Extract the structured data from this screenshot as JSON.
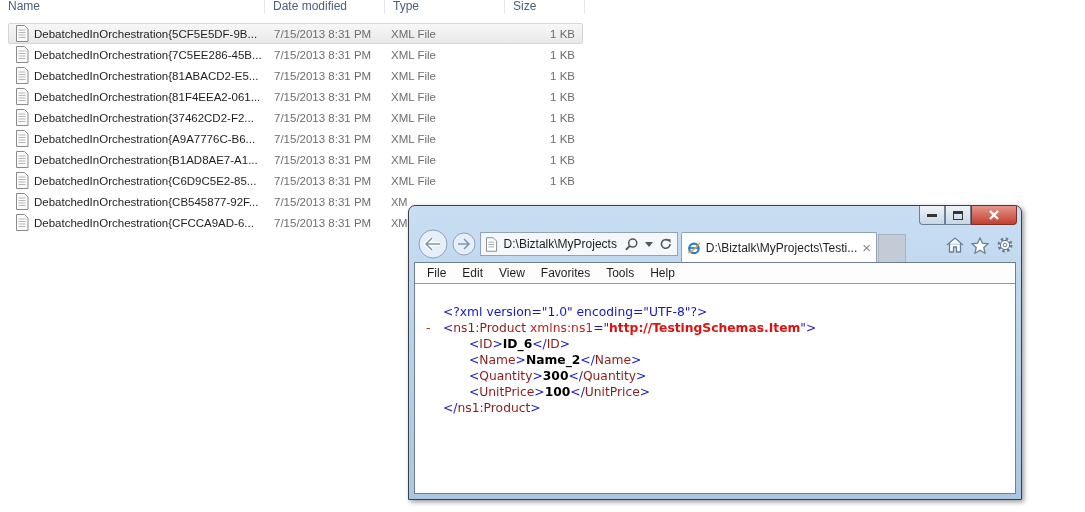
{
  "explorer": {
    "columns": [
      "Name",
      "Date modified",
      "Type",
      "Size"
    ],
    "rows": [
      {
        "name": "DebatchedInOrchestration{5CF5E5DF-9B...",
        "date": "7/15/2013 8:31 PM",
        "type": "XML File",
        "size": "1 KB",
        "selected": true
      },
      {
        "name": "DebatchedInOrchestration{7C5EE286-45B...",
        "date": "7/15/2013 8:31 PM",
        "type": "XML File",
        "size": "1 KB",
        "selected": false
      },
      {
        "name": "DebatchedInOrchestration{81ABACD2-E5...",
        "date": "7/15/2013 8:31 PM",
        "type": "XML File",
        "size": "1 KB",
        "selected": false
      },
      {
        "name": "DebatchedInOrchestration{81F4EEA2-061...",
        "date": "7/15/2013 8:31 PM",
        "type": "XML File",
        "size": "1 KB",
        "selected": false
      },
      {
        "name": "DebatchedInOrchestration{37462CD2-F2...",
        "date": "7/15/2013 8:31 PM",
        "type": "XML File",
        "size": "1 KB",
        "selected": false
      },
      {
        "name": "DebatchedInOrchestration{A9A7776C-B6...",
        "date": "7/15/2013 8:31 PM",
        "type": "XML File",
        "size": "1 KB",
        "selected": false
      },
      {
        "name": "DebatchedInOrchestration{B1AD8AE7-A1...",
        "date": "7/15/2013 8:31 PM",
        "type": "XML File",
        "size": "1 KB",
        "selected": false
      },
      {
        "name": "DebatchedInOrchestration{C6D9C5E2-85...",
        "date": "7/15/2013 8:31 PM",
        "type": "XML File",
        "size": "1 KB",
        "selected": false
      },
      {
        "name": "DebatchedInOrchestration{CB545877-92F...",
        "date": "7/15/2013 8:31 PM",
        "type": "XM",
        "selected": false
      },
      {
        "name": "DebatchedInOrchestration{CFCCA9AD-6...",
        "date": "7/15/2013 8:31 PM",
        "type": "XM",
        "selected": false
      }
    ]
  },
  "browser": {
    "address": "D:\\Biztalk\\MyProjects",
    "tab": {
      "title": "D:\\Biztalk\\MyProjects\\Testi...",
      "close": "×"
    },
    "menu": [
      "File",
      "Edit",
      "View",
      "Favorites",
      "Tools",
      "Help"
    ],
    "xml": {
      "declaration": "<?xml version=\"1.0\" encoding=\"UTF-8\"?>",
      "root": {
        "toggle": "-",
        "open": [
          {
            "kind": "bracket",
            "text": "<"
          },
          {
            "kind": "tag",
            "text": "ns1:Product"
          },
          {
            "kind": "attr",
            "text": " xmlns:ns1"
          },
          {
            "kind": "bracket",
            "text": "=\""
          },
          {
            "kind": "attrval",
            "text": "http://TestingSchemas.Item"
          },
          {
            "kind": "bracket",
            "text": "\">"
          }
        ],
        "children": [
          {
            "tokens": [
              {
                "kind": "bracket",
                "text": "<"
              },
              {
                "kind": "tag",
                "text": "ID"
              },
              {
                "kind": "bracket",
                "text": ">"
              },
              {
                "kind": "text",
                "text": "ID_6"
              },
              {
                "kind": "bracket",
                "text": "</"
              },
              {
                "kind": "tag",
                "text": "ID"
              },
              {
                "kind": "bracket",
                "text": ">"
              }
            ]
          },
          {
            "tokens": [
              {
                "kind": "bracket",
                "text": "<"
              },
              {
                "kind": "tag",
                "text": "Name"
              },
              {
                "kind": "bracket",
                "text": ">"
              },
              {
                "kind": "text",
                "text": "Name_2"
              },
              {
                "kind": "bracket",
                "text": "</"
              },
              {
                "kind": "tag",
                "text": "Name"
              },
              {
                "kind": "bracket",
                "text": ">"
              }
            ]
          },
          {
            "tokens": [
              {
                "kind": "bracket",
                "text": "<"
              },
              {
                "kind": "tag",
                "text": "Quantity"
              },
              {
                "kind": "bracket",
                "text": ">"
              },
              {
                "kind": "text",
                "text": "300"
              },
              {
                "kind": "bracket",
                "text": "</"
              },
              {
                "kind": "tag",
                "text": "Quantity"
              },
              {
                "kind": "bracket",
                "text": ">"
              }
            ]
          },
          {
            "tokens": [
              {
                "kind": "bracket",
                "text": "<"
              },
              {
                "kind": "tag",
                "text": "UnitPrice"
              },
              {
                "kind": "bracket",
                "text": ">"
              },
              {
                "kind": "text",
                "text": "100"
              },
              {
                "kind": "bracket",
                "text": "</"
              },
              {
                "kind": "tag",
                "text": "UnitPrice"
              },
              {
                "kind": "bracket",
                "text": ">"
              }
            ]
          }
        ],
        "close": [
          {
            "kind": "bracket",
            "text": "</"
          },
          {
            "kind": "tag",
            "text": "ns1:Product"
          },
          {
            "kind": "bracket",
            "text": ">"
          }
        ]
      }
    }
  }
}
